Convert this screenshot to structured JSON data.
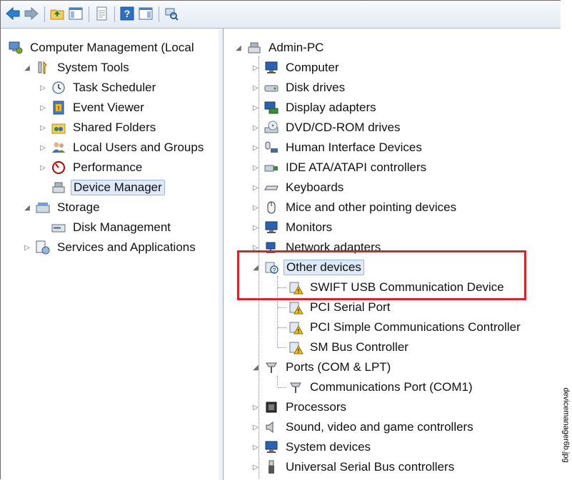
{
  "left_tree": {
    "root": "Computer Management (Local",
    "items": [
      {
        "label": "System Tools"
      },
      {
        "label": "Task Scheduler"
      },
      {
        "label": "Event Viewer"
      },
      {
        "label": "Shared Folders"
      },
      {
        "label": "Local Users and Groups"
      },
      {
        "label": "Performance"
      },
      {
        "label": "Device Manager"
      },
      {
        "label": "Storage"
      },
      {
        "label": "Disk Management"
      },
      {
        "label": "Services and Applications"
      }
    ]
  },
  "right_tree": {
    "root": "Admin-PC",
    "items": [
      {
        "label": "Computer"
      },
      {
        "label": "Disk drives"
      },
      {
        "label": "Display adapters"
      },
      {
        "label": "DVD/CD-ROM drives"
      },
      {
        "label": "Human Interface Devices"
      },
      {
        "label": "IDE ATA/ATAPI controllers"
      },
      {
        "label": "Keyboards"
      },
      {
        "label": "Mice and other pointing devices"
      },
      {
        "label": "Monitors"
      },
      {
        "label": "Network adapters"
      },
      {
        "label": "Other devices"
      },
      {
        "label": "SWIFT USB Communication Device"
      },
      {
        "label": "PCI Serial Port"
      },
      {
        "label": "PCI Simple Communications Controller"
      },
      {
        "label": "SM Bus Controller"
      },
      {
        "label": "Ports (COM & LPT)"
      },
      {
        "label": "Communications Port (COM1)"
      },
      {
        "label": "Processors"
      },
      {
        "label": "Sound, video and game controllers"
      },
      {
        "label": "System devices"
      },
      {
        "label": "Universal Serial Bus controllers"
      }
    ]
  },
  "watermark": "devicemanager6b.jpg",
  "colors": {
    "highlight_box": "#e0202b",
    "selection": "#dfe9f7",
    "warning": "#f2c200"
  }
}
